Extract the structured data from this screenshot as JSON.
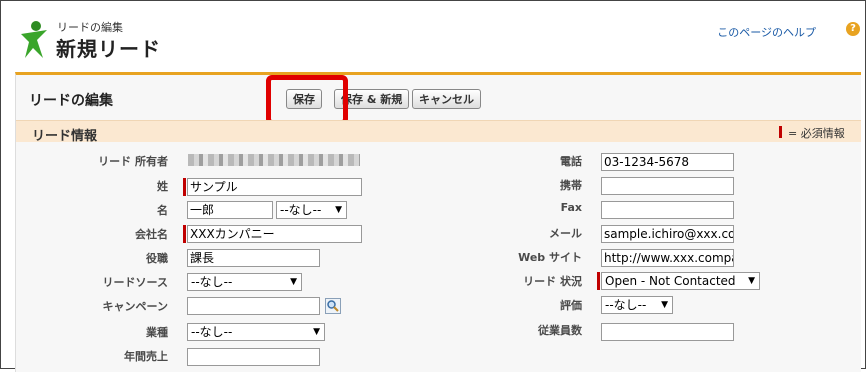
{
  "header": {
    "breadcrumb": "リードの編集",
    "title": "新規リード",
    "help_link": "このページのヘルプ",
    "help_icon": "?"
  },
  "panel": {
    "title": "リードの編集",
    "buttons": {
      "save": "保存",
      "save_new": "保存 & 新規",
      "cancel": "キャンセル"
    },
    "section_title": "リード情報",
    "required_legend": "= 必須情報"
  },
  "form": {
    "left": {
      "owner": {
        "label": "リード 所有者"
      },
      "last_name": {
        "label": "姓",
        "value": "サンプル"
      },
      "first_name": {
        "label": "名",
        "value": "一郎",
        "salutation": "--なし--"
      },
      "company": {
        "label": "会社名",
        "value": "XXXカンパニー"
      },
      "title": {
        "label": "役職",
        "value": "課長"
      },
      "lead_source": {
        "label": "リードソース",
        "value": "--なし--"
      },
      "campaign": {
        "label": "キャンペーン",
        "value": ""
      },
      "industry": {
        "label": "業種",
        "value": "--なし--"
      },
      "annual_revenue": {
        "label": "年間売上",
        "value": ""
      }
    },
    "right": {
      "phone": {
        "label": "電話",
        "value": "03-1234-5678"
      },
      "mobile": {
        "label": "携帯",
        "value": ""
      },
      "fax": {
        "label": "Fax",
        "value": ""
      },
      "email": {
        "label": "メール",
        "value": "sample.ichiro@xxx.comp"
      },
      "website": {
        "label": "Web サイト",
        "value": "http://www.xxx.compar"
      },
      "lead_status": {
        "label": "リード 状況",
        "value": "Open - Not Contacted"
      },
      "rating": {
        "label": "評価",
        "value": "--なし--"
      },
      "employees": {
        "label": "従業員数",
        "value": ""
      }
    }
  },
  "colors": {
    "accent": "#e8a321",
    "required": "#c00000",
    "highlight": "#e00000",
    "section_bg": "#fbe8d1"
  }
}
